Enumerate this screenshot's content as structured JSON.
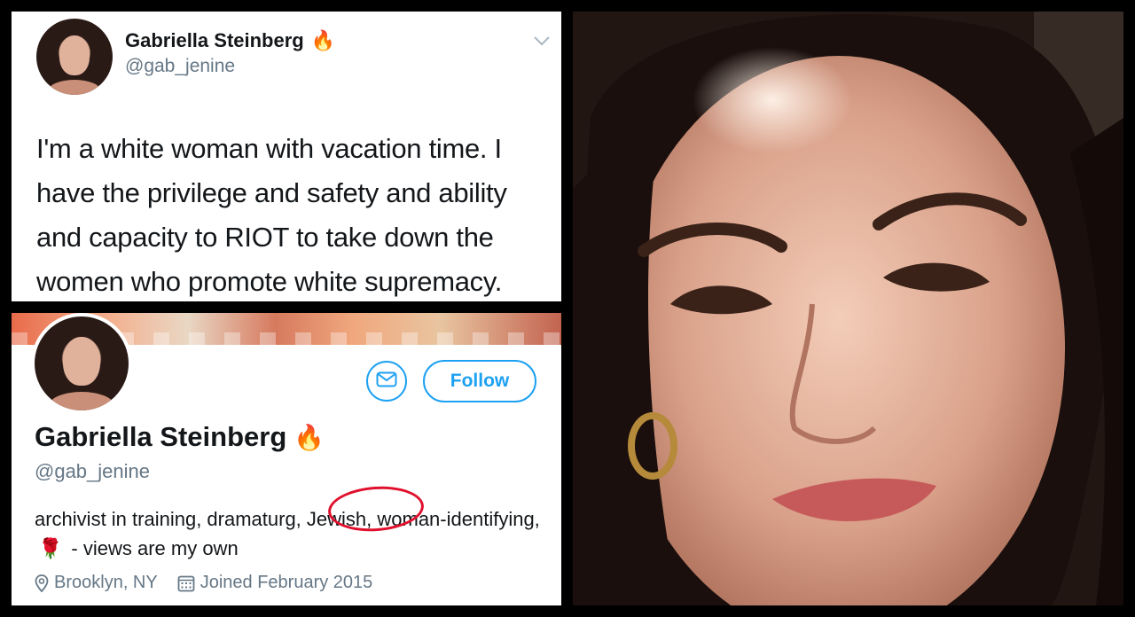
{
  "tweet": {
    "name": "Gabriella Steinberg",
    "name_emoji": "🔥",
    "handle": "@gab_jenine",
    "text": "I'm a white woman with vacation time. I have the privilege and safety and ability and capacity to RIOT to take down the women who promote white supremacy."
  },
  "profile": {
    "follow_label": "Follow",
    "name": "Gabriella Steinberg",
    "name_emoji": "🔥",
    "handle": "@gab_jenine",
    "bio_part1": "archivist in training, dramaturg, Jewish, woman-identifying,",
    "bio_rose": "🌹",
    "bio_part2": "- views are my own",
    "location": "Brooklyn, NY",
    "joined": "Joined February 2015"
  },
  "colors": {
    "accent": "#1da1f2",
    "annotation_circle": "#e0102d"
  },
  "icons": [
    "chevron-down-icon",
    "mail-icon",
    "location-pin-icon",
    "calendar-icon",
    "fire-icon",
    "rose-icon"
  ]
}
